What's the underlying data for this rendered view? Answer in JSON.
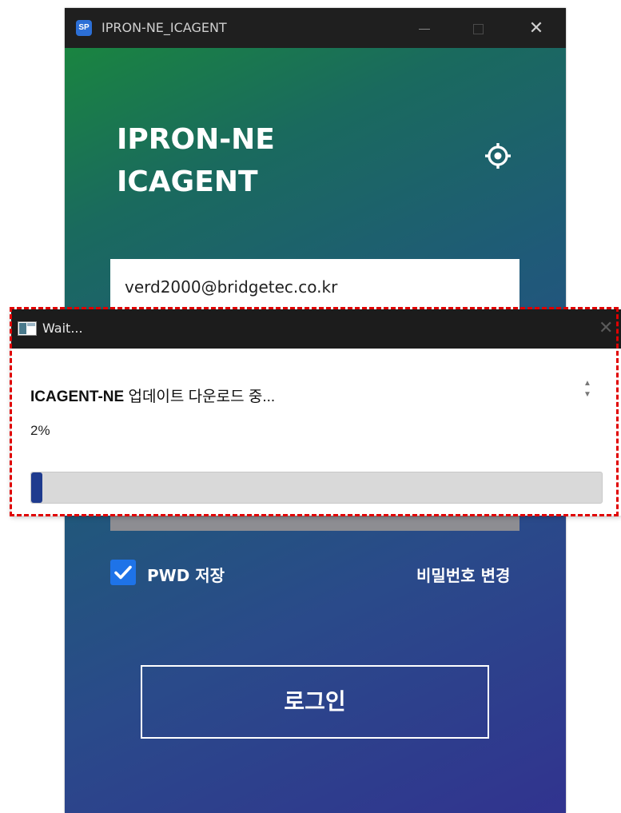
{
  "app_window": {
    "title": "IPRON-NE_ICAGENT",
    "logo": "SP",
    "brand_line1": "IPRON-NE",
    "brand_line2": "ICAGENT",
    "settings_icon": "gear-icon",
    "id_value": "verd2000@bridgetec.co.kr",
    "remember_label": "PWD 저장",
    "remember_checked": true,
    "change_password_label": "비밀번호 변경",
    "login_label": "로그인",
    "colors": {
      "gradient_start": "#1a8a3a",
      "gradient_end": "#31338f",
      "checkbox": "#1e73e8"
    }
  },
  "wait_dialog": {
    "title": "Wait...",
    "message_bold": "ICAGENT-NE",
    "message_rest": " 업데이트 다운로드 중...",
    "percent_text": "2%",
    "progress": 0.02,
    "colors": {
      "progress_fill": "#1f3b8e",
      "highlight": "#e00000"
    }
  }
}
